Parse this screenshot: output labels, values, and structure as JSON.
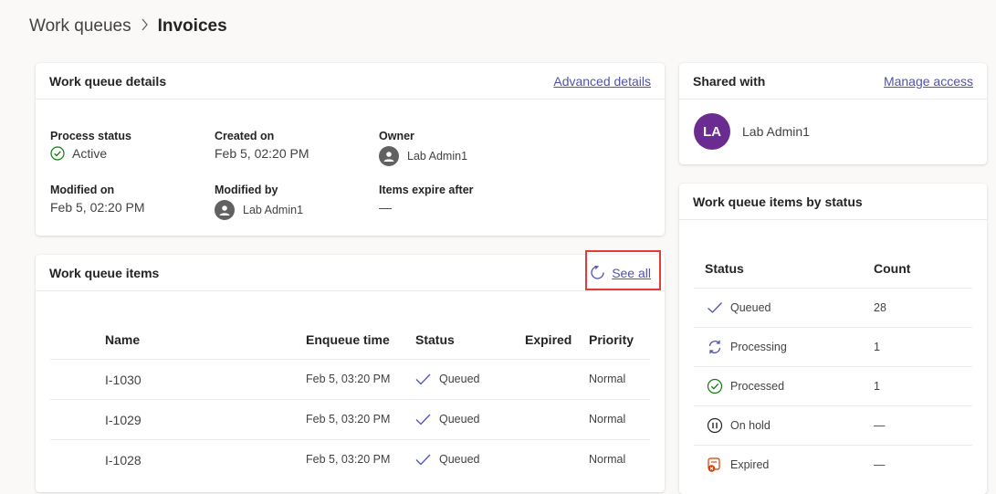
{
  "breadcrumb": {
    "parent": "Work queues",
    "current": "Invoices"
  },
  "details": {
    "title": "Work queue details",
    "advanced_link": "Advanced details",
    "process_status_label": "Process status",
    "process_status_value": "Active",
    "created_on_label": "Created on",
    "created_on_value": "Feb 5, 02:20 PM",
    "owner_label": "Owner",
    "owner_value": "Lab Admin1",
    "modified_on_label": "Modified on",
    "modified_on_value": "Feb 5, 02:20 PM",
    "modified_by_label": "Modified by",
    "modified_by_value": "Lab Admin1",
    "expire_label": "Items expire after",
    "expire_value": "—"
  },
  "shared": {
    "title": "Shared with",
    "manage_link": "Manage access",
    "avatar_initials": "LA",
    "avatar_color": "#6b2c91",
    "user": "Lab Admin1"
  },
  "items": {
    "title": "Work queue items",
    "see_all": "See all",
    "columns": [
      "Name",
      "Enqueue time",
      "Status",
      "Expired",
      "Priority"
    ],
    "rows": [
      {
        "name": "I-1030",
        "time": "Feb 5, 03:20 PM",
        "status": "Queued",
        "expired": "",
        "priority": "Normal"
      },
      {
        "name": "I-1029",
        "time": "Feb 5, 03:20 PM",
        "status": "Queued",
        "expired": "",
        "priority": "Normal"
      },
      {
        "name": "I-1028",
        "time": "Feb 5, 03:20 PM",
        "status": "Queued",
        "expired": "",
        "priority": "Normal"
      }
    ]
  },
  "by_status": {
    "title": "Work queue items by status",
    "columns": [
      "Status",
      "Count"
    ],
    "rows": [
      {
        "status": "Queued",
        "count": "28",
        "icon": "check-icon"
      },
      {
        "status": "Processing",
        "count": "1",
        "icon": "processing-icon"
      },
      {
        "status": "Processed",
        "count": "1",
        "icon": "check-circle-icon"
      },
      {
        "status": "On hold",
        "count": "—",
        "icon": "pause-circle-icon"
      },
      {
        "status": "Expired",
        "count": "—",
        "icon": "expired-icon"
      }
    ]
  },
  "colors": {
    "accent": "#4f52b2",
    "success": "#107c10",
    "highlight": "#e03c3c",
    "expired": "#d83b01"
  }
}
